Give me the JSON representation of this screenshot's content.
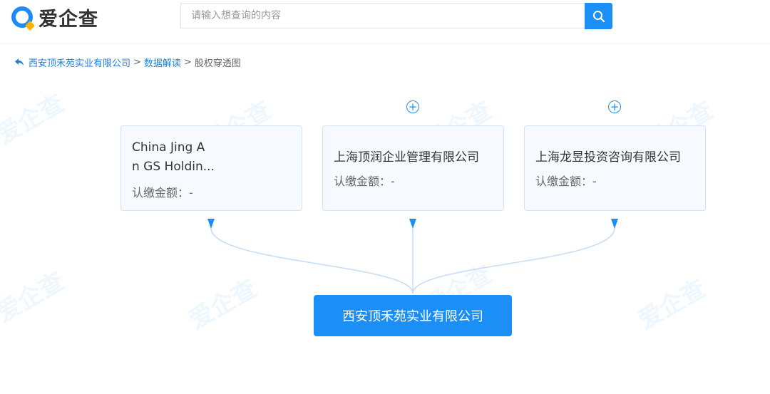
{
  "header": {
    "logo_text": "爱企查",
    "search_placeholder": "请输入想查询的内容"
  },
  "breadcrumb": {
    "items": [
      "西安顶禾苑实业有限公司",
      "数据解读",
      "股权穿透图"
    ],
    "separator": ">"
  },
  "watermark_text": "爱企查",
  "shareholders": [
    {
      "name_line1": "China Jing A",
      "name_line2": "n GS Holdin...",
      "amount": "认缴金额：-"
    },
    {
      "name_line1": "上海顶润企业管理有限公司",
      "name_line2": "",
      "amount": "认缴金额：-"
    },
    {
      "name_line1": "上海龙昱投资咨询有限公司",
      "name_line2": "",
      "amount": "认缴金额：-"
    }
  ],
  "expand_symbol": "+",
  "target_company": "西安顶禾苑实业有限公司",
  "colors": {
    "accent": "#1b8ff6",
    "card_border": "#cfe3f9",
    "line": "#c5dcf6"
  }
}
